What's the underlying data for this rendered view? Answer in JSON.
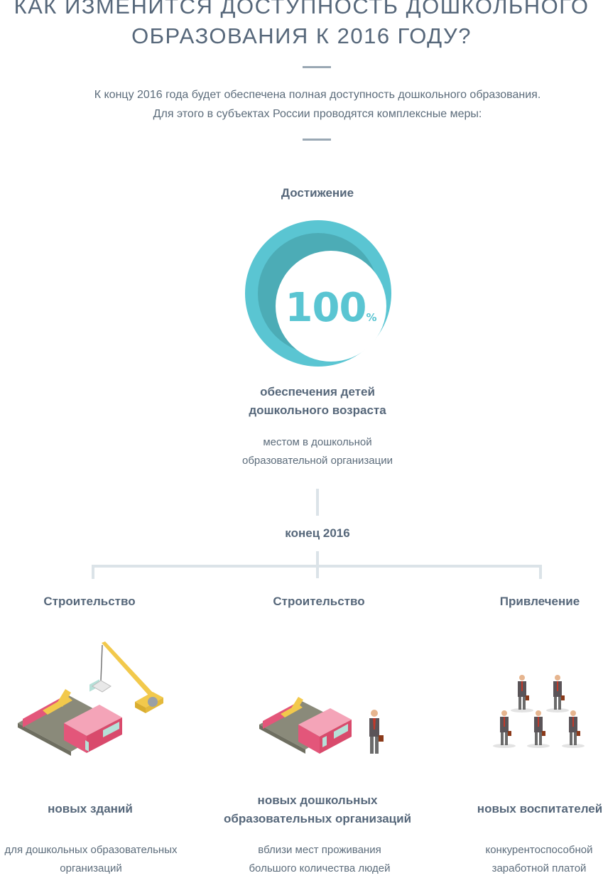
{
  "header": {
    "title_line1": "Как изменится доступность дошкольного",
    "title_line2": "образования к 2016 году?"
  },
  "intro": {
    "line1": "К концу 2016 года будет обеспечена полная доступность дошкольного образования.",
    "line2": "Для этого в субъектах России проводятся комплексные меры:"
  },
  "achievement": {
    "label": "Достижение",
    "value": "100",
    "unit": "%",
    "title_line1": "обеспечения детей",
    "title_line2": "дошкольного возраста",
    "sub_line1": "местом в дошкольной",
    "sub_line2": "образовательной организации",
    "deadline": "конец 2016"
  },
  "columns": [
    {
      "title": "Строительство",
      "icon": "construction-crane-icon",
      "bold_line1": "новых зданий",
      "bold_line2": "",
      "sub_line1": "для дошкольных образовательных",
      "sub_line2": "организаций"
    },
    {
      "title": "Строительство",
      "icon": "building-with-person-icon",
      "bold_line1": "новых дошкольных",
      "bold_line2": "образовательных организаций",
      "sub_line1": "вблизи мест проживания",
      "sub_line2": "большого количества людей"
    },
    {
      "title": "Привлечение",
      "icon": "group-of-people-icon",
      "bold_line1": "новых воспитателей",
      "bold_line2": "",
      "sub_line1": "конкурентоспособной",
      "sub_line2": "заработной платой"
    }
  ],
  "colors": {
    "accent": "#5ac5d2",
    "accent_dark": "#4cacb6",
    "text": "#56677a",
    "connector": "#dbe3e8",
    "building": "#e3567a"
  }
}
